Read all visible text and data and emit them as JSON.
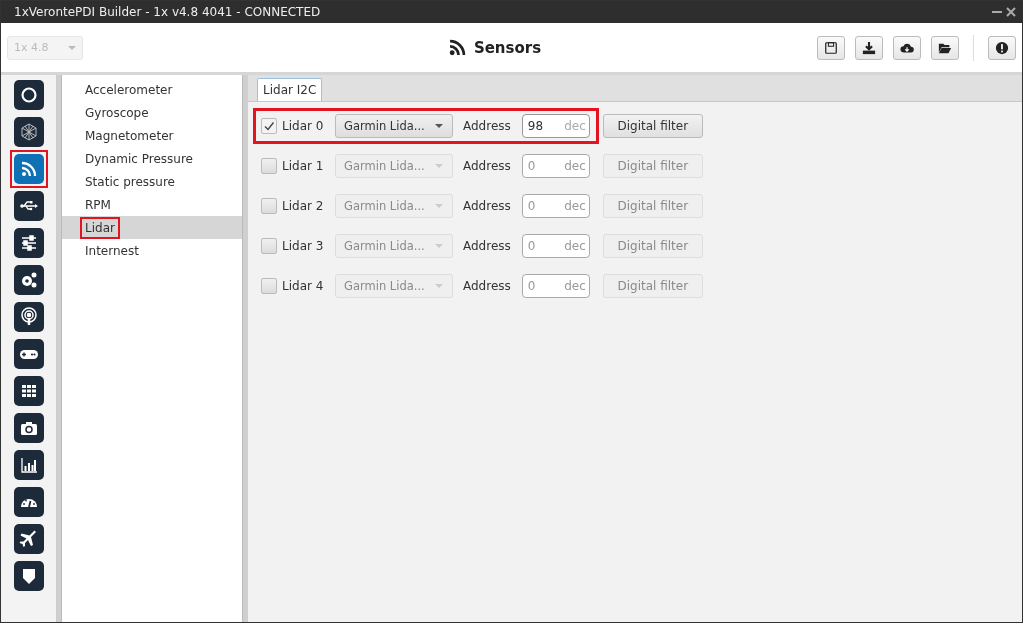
{
  "window": {
    "title": "1xVerontePDI Builder - 1x v4.8 4041 - CONNECTED"
  },
  "version_select": {
    "value": "1x 4.8",
    "disabled": true
  },
  "header": {
    "title": "Sensors"
  },
  "toolbar": [
    {
      "kind": "save"
    },
    {
      "kind": "download"
    },
    {
      "kind": "cloud"
    },
    {
      "kind": "folder"
    },
    {
      "kind": "alert"
    }
  ],
  "nav_icons": [
    {
      "kind": "power",
      "selected": false,
      "highlighted": false
    },
    {
      "kind": "hexagon",
      "selected": false,
      "highlighted": false
    },
    {
      "kind": "rss",
      "selected": true,
      "highlighted": true
    },
    {
      "kind": "usb",
      "selected": false,
      "highlighted": false
    },
    {
      "kind": "sliders",
      "selected": false,
      "highlighted": false
    },
    {
      "kind": "gears",
      "selected": false,
      "highlighted": false
    },
    {
      "kind": "podcast",
      "selected": false,
      "highlighted": false
    },
    {
      "kind": "gamepad",
      "selected": false,
      "highlighted": false
    },
    {
      "kind": "grid",
      "selected": false,
      "highlighted": false
    },
    {
      "kind": "camera",
      "selected": false,
      "highlighted": false
    },
    {
      "kind": "chart",
      "selected": false,
      "highlighted": false
    },
    {
      "kind": "gauge",
      "selected": false,
      "highlighted": false
    },
    {
      "kind": "plane",
      "selected": false,
      "highlighted": false
    },
    {
      "kind": "shield",
      "selected": false,
      "highlighted": false
    }
  ],
  "sensor_list": [
    {
      "label": "Accelerometer",
      "selected": false,
      "highlighted": false
    },
    {
      "label": "Gyroscope",
      "selected": false,
      "highlighted": false
    },
    {
      "label": "Magnetometer",
      "selected": false,
      "highlighted": false
    },
    {
      "label": "Dynamic Pressure",
      "selected": false,
      "highlighted": false
    },
    {
      "label": "Static pressure",
      "selected": false,
      "highlighted": false
    },
    {
      "label": "RPM",
      "selected": false,
      "highlighted": false
    },
    {
      "label": "Lidar",
      "selected": true,
      "highlighted": true
    },
    {
      "label": "Internest",
      "selected": false,
      "highlighted": false
    }
  ],
  "tabs": [
    {
      "label": "Lidar I2C",
      "selected": true
    }
  ],
  "lidars": [
    {
      "label": "Lidar 0",
      "checked": true,
      "highlighted": true,
      "model": "Garmin Lida...",
      "address_label": "Address",
      "address": "98",
      "unit": "dec",
      "filter_button": "Digital filter"
    },
    {
      "label": "Lidar 1",
      "checked": false,
      "highlighted": false,
      "model": "Garmin Lida...",
      "address_label": "Address",
      "address": "0",
      "unit": "dec",
      "filter_button": "Digital filter"
    },
    {
      "label": "Lidar 2",
      "checked": false,
      "highlighted": false,
      "model": "Garmin Lida...",
      "address_label": "Address",
      "address": "0",
      "unit": "dec",
      "filter_button": "Digital filter"
    },
    {
      "label": "Lidar 3",
      "checked": false,
      "highlighted": false,
      "model": "Garmin Lida...",
      "address_label": "Address",
      "address": "0",
      "unit": "dec",
      "filter_button": "Digital filter"
    },
    {
      "label": "Lidar 4",
      "checked": false,
      "highlighted": false,
      "model": "Garmin Lida...",
      "address_label": "Address",
      "address": "0",
      "unit": "dec",
      "filter_button": "Digital filter"
    }
  ]
}
